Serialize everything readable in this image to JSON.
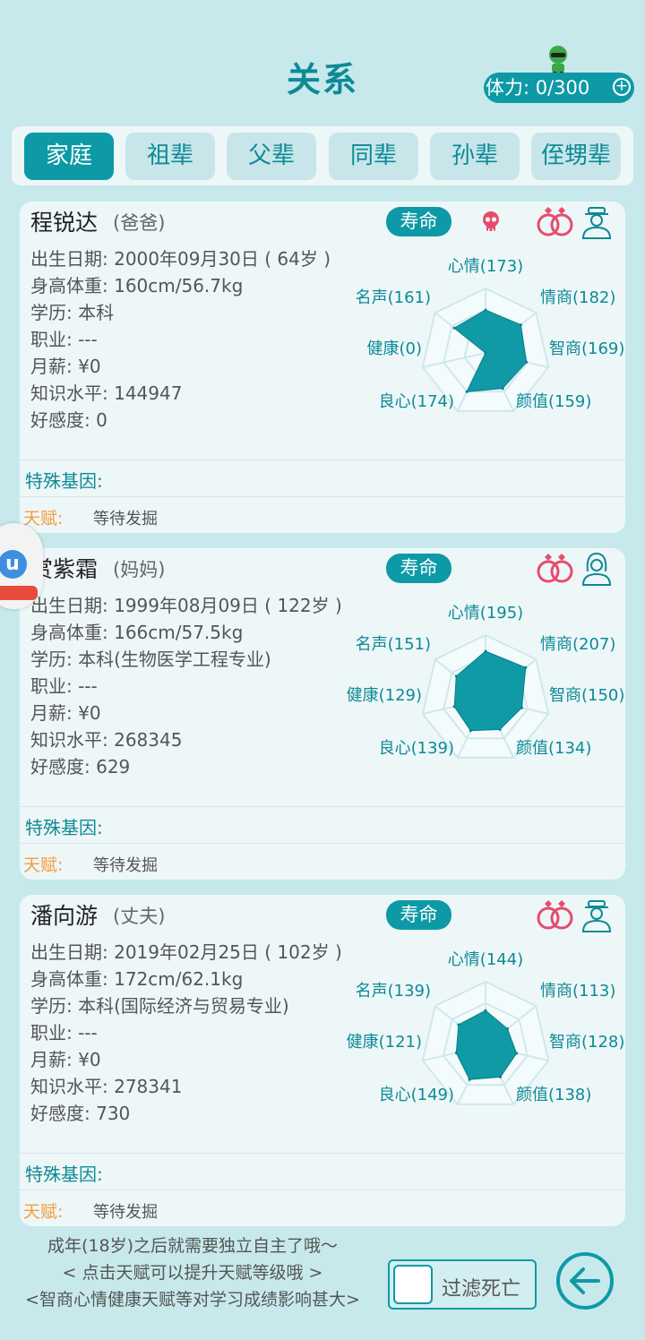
{
  "page": {
    "title": "关系",
    "stamina": "体力: 0/300"
  },
  "tabs": [
    "家庭",
    "祖辈",
    "父辈",
    "同辈",
    "孙辈",
    "侄甥辈"
  ],
  "colors": {
    "accent": "#0d9aa6",
    "background": "#c7e9ec",
    "talent": "#f39c3f"
  },
  "labels": {
    "lifespan": "寿命",
    "special_gene": "特殊基因:",
    "talent": "天赋:",
    "talent_value": "等待发掘"
  },
  "cards": [
    {
      "name": "程锐达",
      "relation": "(爸爸)",
      "deceased": true,
      "gender": "male",
      "birth": "出生日期: 2000年09月30日 ( 64岁 )",
      "body": "身高体重: 160cm/56.7kg",
      "education": "学历: 本科",
      "job": "职业: ---",
      "salary": "月薪: ¥0",
      "knowledge": "知识水平: 144947",
      "favor": "好感度: 0",
      "radar": {
        "labels": [
          "心情(173)",
          "情商(182)",
          "智商(169)",
          "颜值(159)",
          "良心(174)",
          "健康(0)",
          "名声(161)"
        ],
        "values": [
          173,
          182,
          169,
          159,
          174,
          0,
          161
        ]
      }
    },
    {
      "name": "赏紫霜",
      "relation": "(妈妈)",
      "deceased": false,
      "gender": "female",
      "birth": "出生日期: 1999年08月09日 ( 122岁 )",
      "body": "身高体重: 166cm/57.5kg",
      "education": "学历: 本科(生物医学工程专业)",
      "job": "职业: ---",
      "salary": "月薪: ¥0",
      "knowledge": "知识水平: 268345",
      "favor": "好感度: 629",
      "radar": {
        "labels": [
          "心情(195)",
          "情商(207)",
          "智商(150)",
          "颜值(134)",
          "良心(139)",
          "健康(129)",
          "名声(151)"
        ],
        "values": [
          195,
          207,
          150,
          134,
          139,
          129,
          151
        ]
      }
    },
    {
      "name": "潘向游",
      "relation": "(丈夫)",
      "deceased": false,
      "gender": "male",
      "birth": "出生日期: 2019年02月25日 ( 102岁 )",
      "body": "身高体重: 172cm/62.1kg",
      "education": "学历: 本科(国际经济与贸易专业)",
      "job": "职业: ---",
      "salary": "月薪: ¥0",
      "knowledge": "知识水平: 278341",
      "favor": "好感度: 730",
      "radar": {
        "labels": [
          "心情(144)",
          "情商(113)",
          "智商(128)",
          "颜值(138)",
          "良心(149)",
          "健康(121)",
          "名声(139)"
        ],
        "values": [
          144,
          113,
          128,
          138,
          149,
          121,
          139
        ]
      }
    }
  ],
  "tips": [
    "成年(18岁)之后就需要独立自主了哦〜",
    "< 点击天赋可以提升天赋等级哦 >",
    "<智商心情健康天赋等对学习成绩影响甚大>"
  ],
  "filter": {
    "label": "过滤死亡",
    "checked": false
  }
}
